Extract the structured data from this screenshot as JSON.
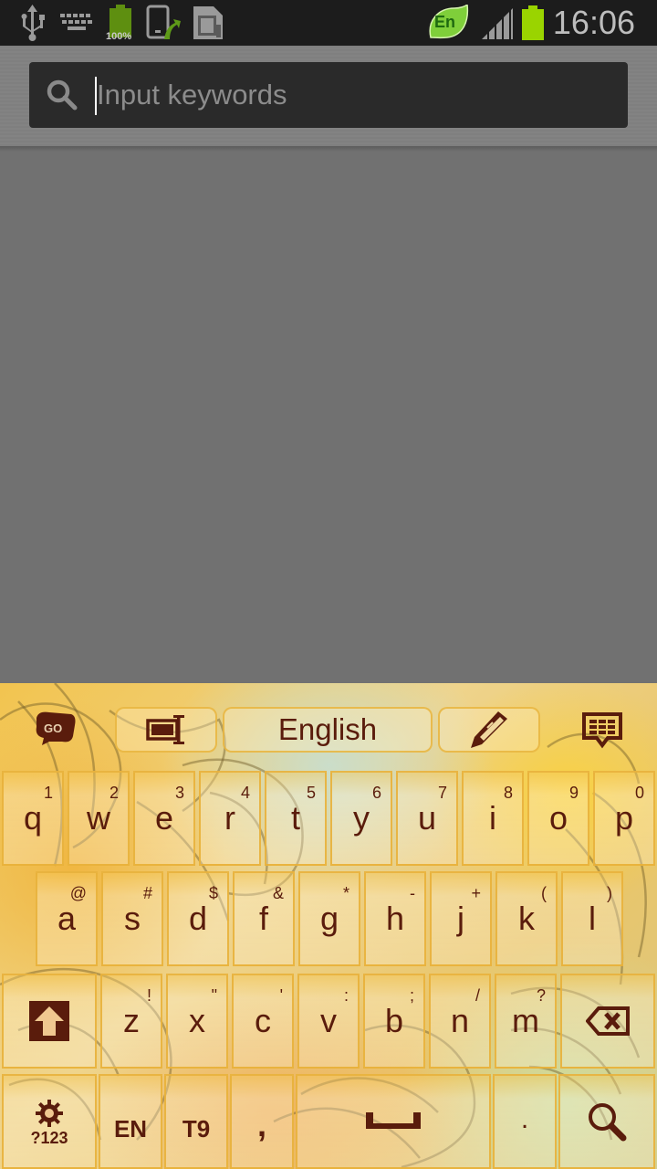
{
  "status_bar": {
    "icons": [
      "usb-icon",
      "keyboard-icon",
      "battery-notification-icon",
      "phone-transfer-icon",
      "sd-card-icon"
    ],
    "battery_notification_label": "100%",
    "language_badge": "En",
    "time": "16:06",
    "colors": {
      "battery": "#9ad400",
      "badge": "#7fcf3a"
    }
  },
  "search": {
    "placeholder": "Input keywords",
    "value": ""
  },
  "keyboard": {
    "toolbar": {
      "go_label": "GO",
      "language_label": "English"
    },
    "rows": [
      [
        {
          "key": "q",
          "hint": "1"
        },
        {
          "key": "w",
          "hint": "2"
        },
        {
          "key": "e",
          "hint": "3"
        },
        {
          "key": "r",
          "hint": "4"
        },
        {
          "key": "t",
          "hint": "5"
        },
        {
          "key": "y",
          "hint": "6"
        },
        {
          "key": "u",
          "hint": "7"
        },
        {
          "key": "i",
          "hint": "8"
        },
        {
          "key": "o",
          "hint": "9"
        },
        {
          "key": "p",
          "hint": "0"
        }
      ],
      [
        {
          "key": "a",
          "hint": "@"
        },
        {
          "key": "s",
          "hint": "#"
        },
        {
          "key": "d",
          "hint": "$"
        },
        {
          "key": "f",
          "hint": "&"
        },
        {
          "key": "g",
          "hint": "*"
        },
        {
          "key": "h",
          "hint": "-"
        },
        {
          "key": "j",
          "hint": "+"
        },
        {
          "key": "k",
          "hint": "("
        },
        {
          "key": "l",
          "hint": ")"
        }
      ],
      [
        {
          "key": "z",
          "hint": "!"
        },
        {
          "key": "x",
          "hint": "\""
        },
        {
          "key": "c",
          "hint": "'"
        },
        {
          "key": "v",
          "hint": ":"
        },
        {
          "key": "b",
          "hint": ";"
        },
        {
          "key": "n",
          "hint": "/"
        },
        {
          "key": "m",
          "hint": "?"
        }
      ]
    ],
    "bottom": {
      "symbols_label": "?123",
      "lang_label": "EN",
      "t9_label": "T9",
      "comma_label": ",",
      "period_label": "."
    },
    "colors": {
      "text": "#5a1c0c",
      "key_border": "#e8b038"
    }
  }
}
